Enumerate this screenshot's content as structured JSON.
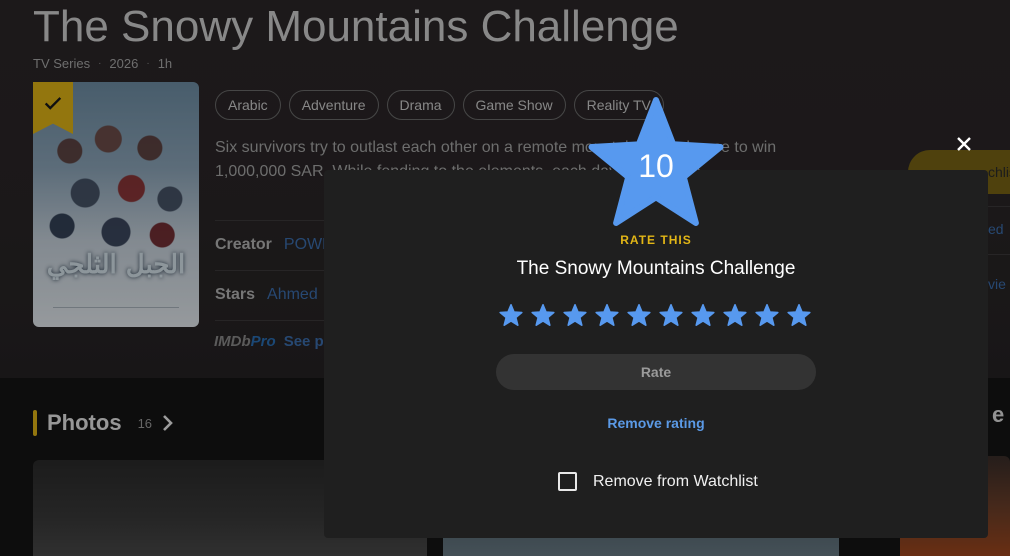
{
  "page": {
    "title": "The Snowy Mountains Challenge",
    "meta": [
      "TV Series",
      "2026",
      "1h"
    ],
    "genres": [
      "Arabic",
      "Adventure",
      "Drama",
      "Game Show",
      "Reality TV"
    ],
    "plot": "Six survivors try to outlast each other on a remote mountain for a chance to win 1,000,000 SAR. While fending to the elements, each day to track the",
    "creator_label": "Creator",
    "creator_value": "POWR",
    "stars_label": "Stars",
    "stars_value": "Ahmed",
    "imdbpro_logo_a": "IMDb",
    "imdbpro_logo_b": "Pro",
    "imdbpro_link": "See pr",
    "poster_arabic": "الجبل الثلجي",
    "side_button_label": "chlis",
    "side_text_1": "ed",
    "side_text_2": "vie",
    "photos_label": "Photos",
    "photos_count": "16",
    "more_hint": "e",
    "icons": [
      "check-icon",
      "chevron-right-icon",
      "close-icon",
      "star-icon",
      "checkbox-icon"
    ]
  },
  "rating_modal": {
    "current_rating": "10",
    "eyebrow": "RATE THIS",
    "title": "The Snowy Mountains Challenge",
    "stars_selected": 10,
    "stars_total": 10,
    "rate_button": "Rate",
    "remove_rating": "Remove rating",
    "watchlist_label": "Remove from Watchlist",
    "watchlist_checked": false
  },
  "colors": {
    "accent_gold": "#e2b616",
    "star_blue": "#5799ef",
    "link_blue": "#5b9ae6",
    "modal_bg": "#1f1f1f"
  }
}
